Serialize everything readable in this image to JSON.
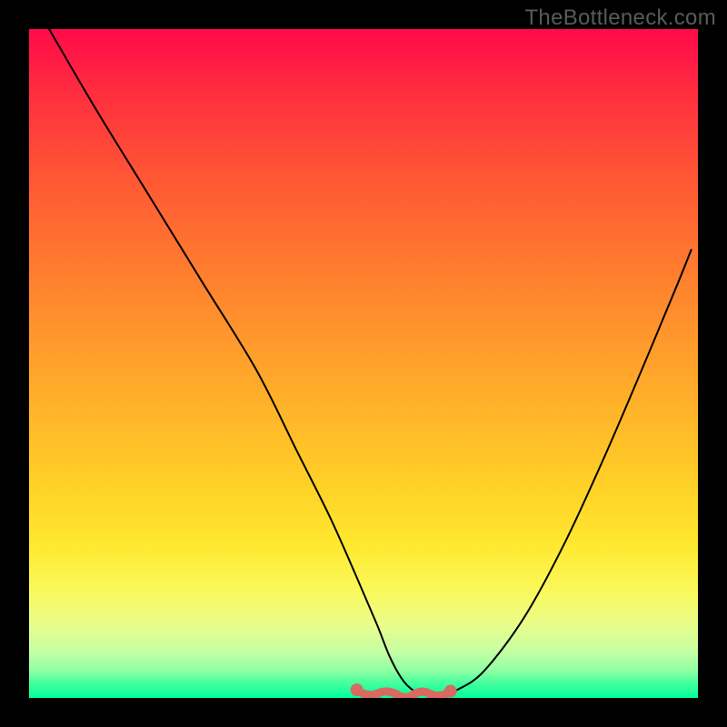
{
  "watermark": "TheBottleneck.com",
  "chart_data": {
    "type": "line",
    "title": "",
    "xlabel": "",
    "ylabel": "",
    "xlim": [
      0,
      100
    ],
    "ylim": [
      0,
      100
    ],
    "grid": false,
    "legend": false,
    "series": [
      {
        "name": "curve",
        "color": "#000000",
        "x": [
          3,
          10,
          18,
          26,
          34,
          40,
          45,
          49,
          52,
          54,
          56,
          58,
          60,
          62,
          64,
          68,
          74,
          80,
          86,
          92,
          97,
          99
        ],
        "y": [
          100,
          88,
          75,
          62,
          49,
          37,
          27,
          18,
          11,
          6,
          2.5,
          0.8,
          0.5,
          0.6,
          1.2,
          4,
          12,
          23,
          36,
          50,
          62,
          67
        ]
      }
    ],
    "markers": {
      "name": "bottom-markers",
      "color": "#d86a64",
      "x": [
        49,
        52,
        55,
        57.5,
        60,
        63
      ],
      "y": [
        1.2,
        0.6,
        0.5,
        0.5,
        0.55,
        1.0
      ]
    },
    "gradient_stops": [
      {
        "pos": 0.0,
        "hex": "#ff0a4a"
      },
      {
        "pos": 0.1,
        "hex": "#ff2f3e"
      },
      {
        "pos": 0.23,
        "hex": "#ff5934"
      },
      {
        "pos": 0.35,
        "hex": "#ff7a2f"
      },
      {
        "pos": 0.46,
        "hex": "#ff972c"
      },
      {
        "pos": 0.57,
        "hex": "#ffb429"
      },
      {
        "pos": 0.68,
        "hex": "#ffd028"
      },
      {
        "pos": 0.77,
        "hex": "#ffe82f"
      },
      {
        "pos": 0.84,
        "hex": "#faf95b"
      },
      {
        "pos": 0.89,
        "hex": "#e9fd8a"
      },
      {
        "pos": 0.93,
        "hex": "#c6ffa3"
      },
      {
        "pos": 0.96,
        "hex": "#8cffa3"
      },
      {
        "pos": 0.98,
        "hex": "#3dff9e"
      },
      {
        "pos": 1.0,
        "hex": "#00ff9a"
      }
    ]
  }
}
